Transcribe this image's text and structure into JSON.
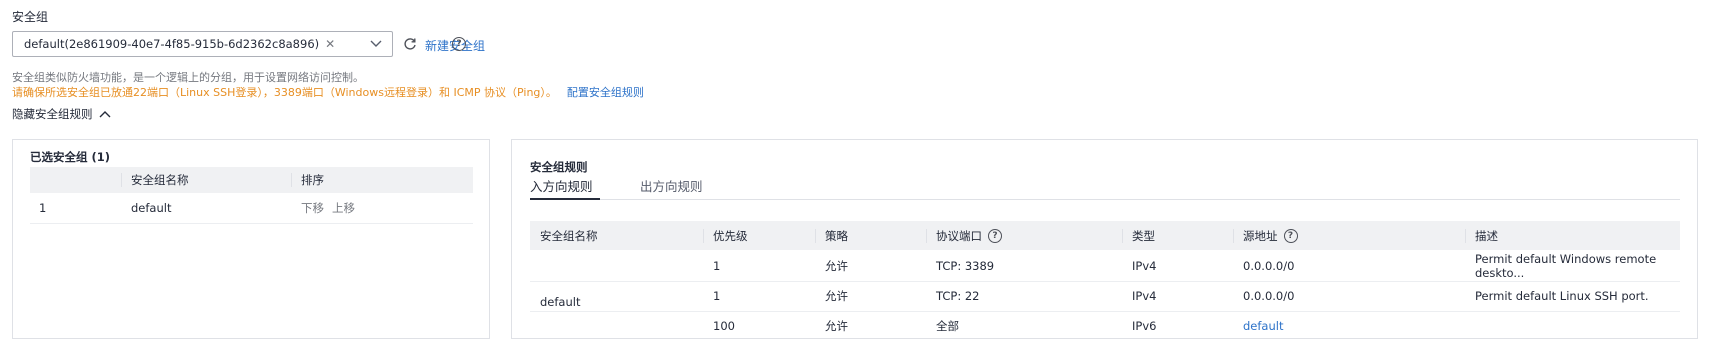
{
  "section": {
    "title": "安全组",
    "selected_tag": "default(2e861909-40e7-4f85-915b-6d2362c8a896)",
    "create_link": "新建安全组",
    "description": "安全组类似防火墙功能，是一个逻辑上的分组，用于设置网络访问控制。",
    "warning": "请确保所选安全组已放通22端口（Linux SSH登录），3389端口（Windows远程登录）和 ICMP 协议（Ping）。",
    "config_link": "配置安全组规则",
    "toggle_label": "隐藏安全组规则"
  },
  "selected_panel": {
    "heading": "已选安全组 (1)",
    "columns": [
      "",
      "安全组名称",
      "排序"
    ],
    "rows": [
      {
        "index": "1",
        "name": "default",
        "move_down": "下移",
        "move_up": "上移"
      }
    ]
  },
  "rules_panel": {
    "heading": "安全组规则",
    "tabs": [
      "入方向规则",
      "出方向规则"
    ],
    "columns": [
      "安全组名称",
      "优先级",
      "策略",
      "协议端口",
      "类型",
      "源地址",
      "描述"
    ],
    "group_name": "default",
    "rows": [
      {
        "priority": "1",
        "policy": "允许",
        "port": "TCP: 3389",
        "type": "IPv4",
        "source": "0.0.0.0/0",
        "description": "Permit default Windows remote deskto..."
      },
      {
        "priority": "1",
        "policy": "允许",
        "port": "TCP: 22",
        "type": "IPv4",
        "source": "0.0.0.0/0",
        "description": "Permit default Linux SSH port."
      },
      {
        "priority": "100",
        "policy": "允许",
        "port": "全部",
        "type": "IPv6",
        "source": "default",
        "description": ""
      }
    ]
  },
  "colors": {
    "link": "#2e73c9",
    "warning": "#e78f24",
    "border": "#dfe1e6",
    "header_bg": "#f0f1f3"
  }
}
